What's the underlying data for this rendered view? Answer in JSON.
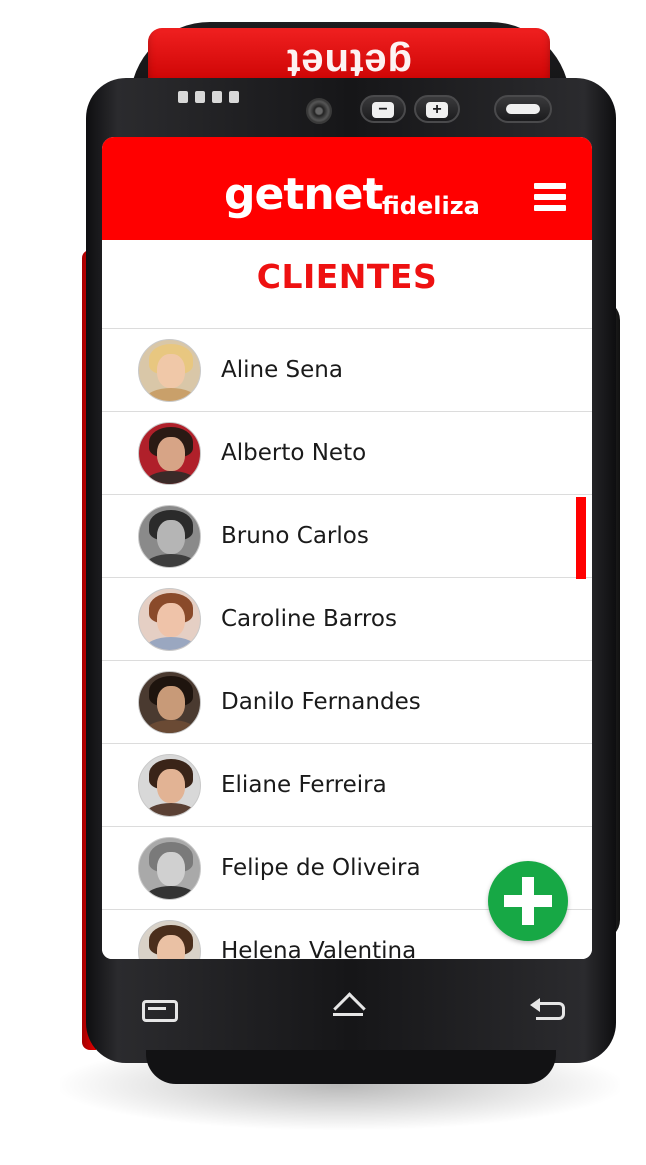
{
  "device": {
    "brand_printed": "getnet",
    "colors": {
      "body": "#161618",
      "accent": "#ff0000"
    },
    "hardware_buttons": [
      {
        "name": "volume-down",
        "glyph": "−"
      },
      {
        "name": "volume-up",
        "glyph": "+"
      },
      {
        "name": "power",
        "glyph": ""
      }
    ]
  },
  "header": {
    "logo_main": "getnet",
    "logo_sub": "fideliza",
    "menu_icon": "hamburger-menu-icon",
    "background": "#ff0000"
  },
  "page": {
    "title": "CLIENTES",
    "title_color": "#ee1111"
  },
  "clients": [
    {
      "name": "Aline Sena"
    },
    {
      "name": "Alberto Neto"
    },
    {
      "name": "Bruno Carlos"
    },
    {
      "name": "Caroline Barros"
    },
    {
      "name": "Danilo Fernandes"
    },
    {
      "name": "Eliane Ferreira"
    },
    {
      "name": "Felipe de Oliveira"
    },
    {
      "name": "Helena Valentina"
    }
  ],
  "fab": {
    "icon": "plus-icon",
    "color": "#17a845"
  },
  "nav_bar": {
    "buttons": [
      "recent-apps-icon",
      "home-icon",
      "back-icon"
    ]
  }
}
